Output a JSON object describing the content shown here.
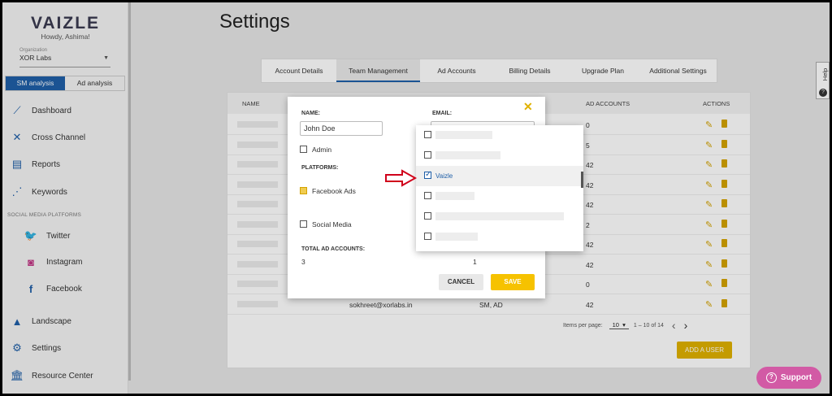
{
  "app": {
    "logo": "VAIZLE",
    "greeting": "Howdy, Ashima!"
  },
  "org": {
    "label": "Organization",
    "value": "XOR Labs"
  },
  "mode_tabs": {
    "active": "SM analysis",
    "inactive": "Ad analysis"
  },
  "nav": [
    {
      "label": "Dashboard",
      "icon": "dashboard-icon"
    },
    {
      "label": "Cross Channel",
      "icon": "cross-channel-icon"
    },
    {
      "label": "Reports",
      "icon": "reports-icon"
    },
    {
      "label": "Keywords",
      "icon": "keywords-icon"
    }
  ],
  "social_section": "SOCIAL MEDIA PLATFORMS",
  "social": [
    {
      "label": "Twitter",
      "icon": "twitter-icon",
      "color": "#1da1f2"
    },
    {
      "label": "Instagram",
      "icon": "instagram-icon",
      "color": "#c13584"
    },
    {
      "label": "Facebook",
      "icon": "facebook-icon",
      "color": "#1f5fa8"
    }
  ],
  "nav_bottom": [
    {
      "label": "Landscape",
      "icon": "landscape-icon"
    },
    {
      "label": "Settings",
      "icon": "settings-icon"
    },
    {
      "label": "Resource Center",
      "icon": "resource-center-icon"
    }
  ],
  "page_title": "Settings",
  "tabs": [
    "Account Details",
    "Team Management",
    "Ad Accounts",
    "Billing Details",
    "Upgrade Plan",
    "Additional Settings"
  ],
  "table": {
    "headers": {
      "name": "NAME",
      "ad_accounts": "AD ACCOUNTS",
      "actions": "ACTIONS"
    },
    "rows": [
      {
        "ad": "0"
      },
      {
        "ad": "5"
      },
      {
        "ad": "42"
      },
      {
        "ad": "42"
      },
      {
        "ad": "42"
      },
      {
        "ad": "2"
      },
      {
        "ad": "42"
      },
      {
        "ad": "42"
      },
      {
        "ad": "0"
      },
      {
        "ad": "42",
        "email": "sokhreet@xorlabs.in",
        "platform": "SM, AD"
      }
    ]
  },
  "pager": {
    "label": "Items per page:",
    "value": "10",
    "range": "1 – 10 of 14"
  },
  "add_user": "ADD A USER",
  "help": "Help",
  "support": "Support",
  "modal": {
    "name_label": "NAME:",
    "name_value": "John Doe",
    "email_label": "EMAIL:",
    "admin": "Admin",
    "platforms_label": "PLATFORMS:",
    "facebook_ads": "Facebook Ads",
    "social_media": "Social Media",
    "total_label": "TOTAL AD ACCOUNTS:",
    "total_left": "3",
    "total_right": "1",
    "cancel": "CANCEL",
    "save": "SAVE"
  },
  "dropdown": {
    "items": [
      {
        "text": "",
        "checked": false
      },
      {
        "text": "",
        "checked": false
      },
      {
        "text": "Vaizle",
        "checked": true
      },
      {
        "text": "",
        "checked": false
      },
      {
        "text": "",
        "checked": false
      },
      {
        "text": "",
        "checked": false
      }
    ]
  },
  "colors": {
    "accent_blue": "#1f5fa8",
    "accent_yellow": "#f6c200",
    "support_pink": "#d25aa5",
    "arrow_red": "#d0021b"
  }
}
